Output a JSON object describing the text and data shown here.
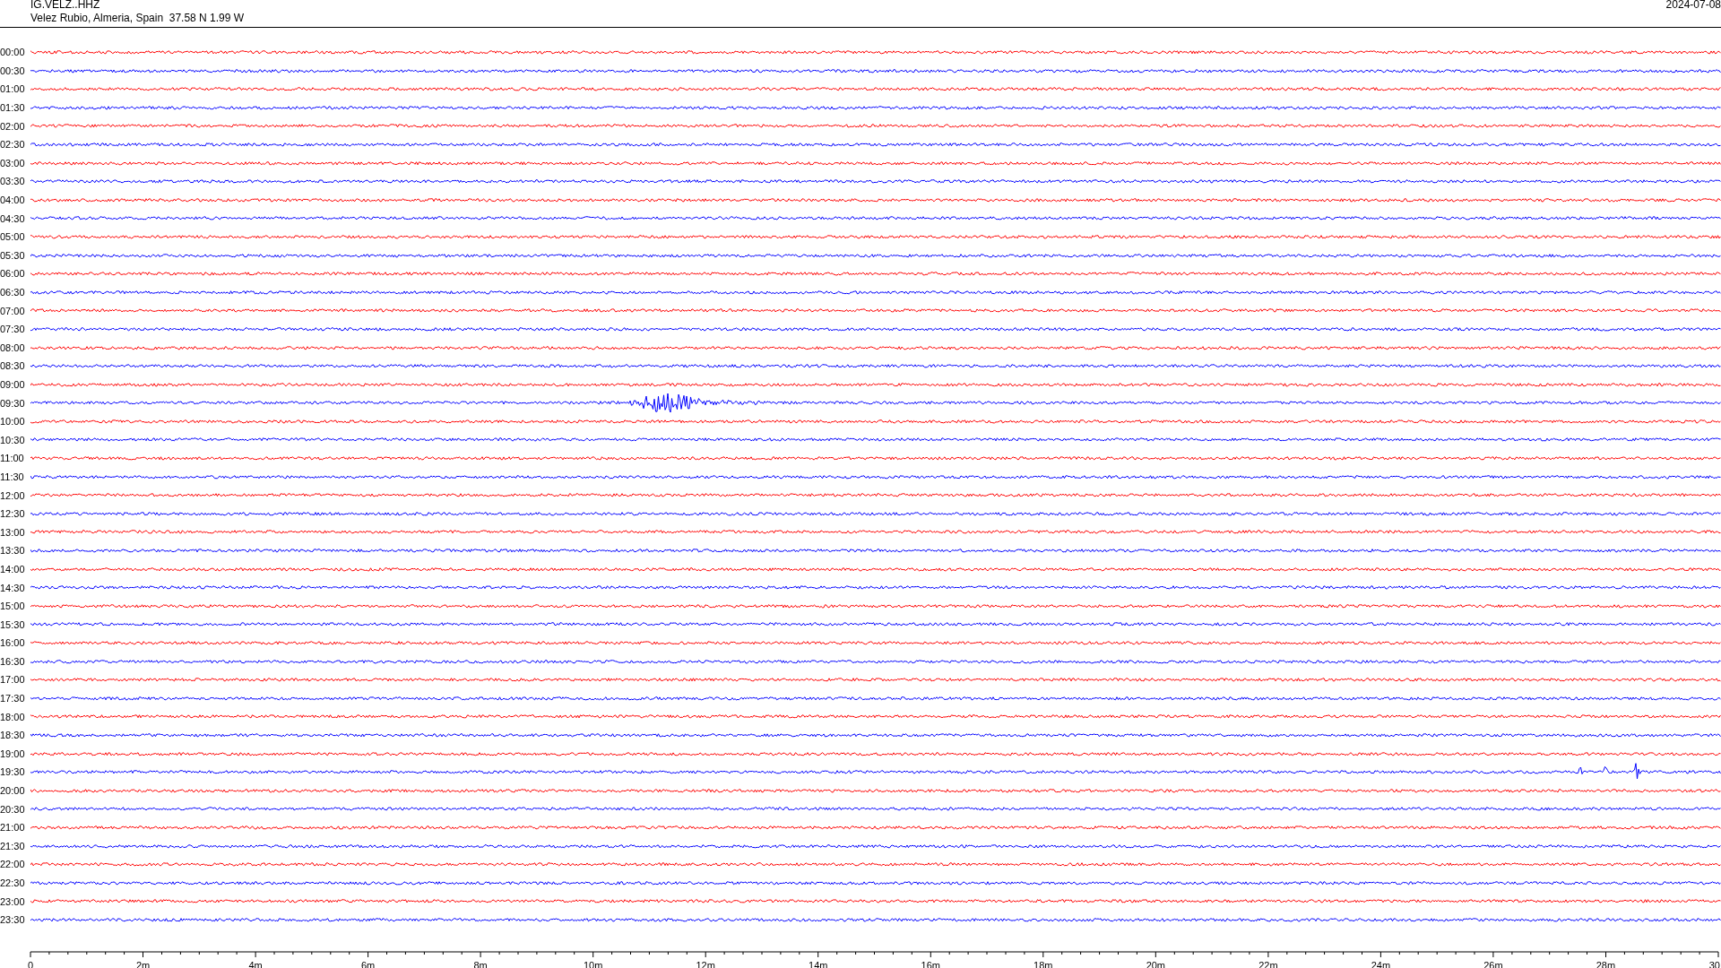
{
  "header": {
    "station": "IG.VELZ..HHZ",
    "location": "Velez Rubio, Almeria, Spain  37.58 N 1.99 W",
    "date": "2024-07-08"
  },
  "rows": [
    {
      "time": "00:00",
      "color": "#ff0000"
    },
    {
      "time": "00:30",
      "color": "#0000ff"
    },
    {
      "time": "01:00",
      "color": "#ff0000"
    },
    {
      "time": "01:30",
      "color": "#0000ff"
    },
    {
      "time": "02:00",
      "color": "#ff0000"
    },
    {
      "time": "02:30",
      "color": "#0000ff"
    },
    {
      "time": "03:00",
      "color": "#ff0000"
    },
    {
      "time": "03:30",
      "color": "#0000ff"
    },
    {
      "time": "04:00",
      "color": "#ff0000"
    },
    {
      "time": "04:30",
      "color": "#0000ff"
    },
    {
      "time": "05:00",
      "color": "#ff0000"
    },
    {
      "time": "05:30",
      "color": "#0000ff"
    },
    {
      "time": "06:00",
      "color": "#ff0000"
    },
    {
      "time": "06:30",
      "color": "#0000ff"
    },
    {
      "time": "07:00",
      "color": "#ff0000"
    },
    {
      "time": "07:30",
      "color": "#0000ff"
    },
    {
      "time": "08:00",
      "color": "#ff0000"
    },
    {
      "time": "08:30",
      "color": "#0000ff"
    },
    {
      "time": "09:00",
      "color": "#ff0000"
    },
    {
      "time": "09:30",
      "color": "#0000ff"
    },
    {
      "time": "10:00",
      "color": "#ff0000"
    },
    {
      "time": "10:30",
      "color": "#0000ff"
    },
    {
      "time": "11:00",
      "color": "#ff0000"
    },
    {
      "time": "11:30",
      "color": "#0000ff"
    },
    {
      "time": "12:00",
      "color": "#ff0000"
    },
    {
      "time": "12:30",
      "color": "#0000ff"
    },
    {
      "time": "13:00",
      "color": "#ff0000"
    },
    {
      "time": "13:30",
      "color": "#0000ff"
    },
    {
      "time": "14:00",
      "color": "#ff0000"
    },
    {
      "time": "14:30",
      "color": "#0000ff"
    },
    {
      "time": "15:00",
      "color": "#ff0000"
    },
    {
      "time": "15:30",
      "color": "#0000ff"
    },
    {
      "time": "16:00",
      "color": "#ff0000"
    },
    {
      "time": "16:30",
      "color": "#0000ff"
    },
    {
      "time": "17:00",
      "color": "#ff0000"
    },
    {
      "time": "17:30",
      "color": "#0000ff"
    },
    {
      "time": "18:00",
      "color": "#ff0000"
    },
    {
      "time": "18:30",
      "color": "#0000ff"
    },
    {
      "time": "19:00",
      "color": "#ff0000"
    },
    {
      "time": "19:30",
      "color": "#0000ff"
    },
    {
      "time": "20:00",
      "color": "#ff0000"
    },
    {
      "time": "20:30",
      "color": "#0000ff"
    },
    {
      "time": "21:00",
      "color": "#ff0000"
    },
    {
      "time": "21:30",
      "color": "#0000ff"
    },
    {
      "time": "22:00",
      "color": "#ff0000"
    },
    {
      "time": "22:30",
      "color": "#0000ff"
    },
    {
      "time": "23:00",
      "color": "#ff0000"
    },
    {
      "time": "23:30",
      "color": "#0000ff"
    }
  ],
  "x_axis": {
    "ticks": [
      "0",
      "2m",
      "4m",
      "6m",
      "8m",
      "10m",
      "12m",
      "14m",
      "16m",
      "18m",
      "20m",
      "22m",
      "24m",
      "26m",
      "28m",
      "30"
    ]
  }
}
